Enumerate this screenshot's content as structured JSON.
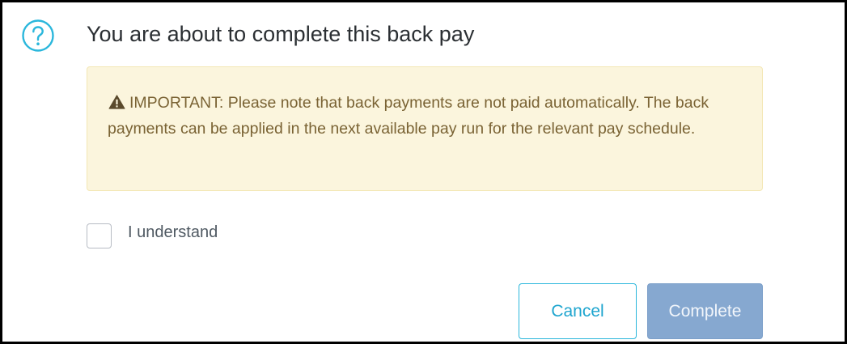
{
  "dialog": {
    "title": "You are about to complete this back pay",
    "title_icon": "question-circle-icon"
  },
  "notice": {
    "icon": "warning-triangle-icon",
    "text": "IMPORTANT: Please note that back payments are not paid automatically. The back payments can be applied in the next available pay run for the relevant pay schedule."
  },
  "acknowledge": {
    "label": "I understand",
    "checked": false
  },
  "actions": {
    "cancel_label": "Cancel",
    "complete_label": "Complete"
  },
  "colors": {
    "accent": "#2bb7dc",
    "notice_background": "#fbf5dd",
    "notice_text": "#7a6334",
    "complete_disabled": "#86a8d0"
  }
}
